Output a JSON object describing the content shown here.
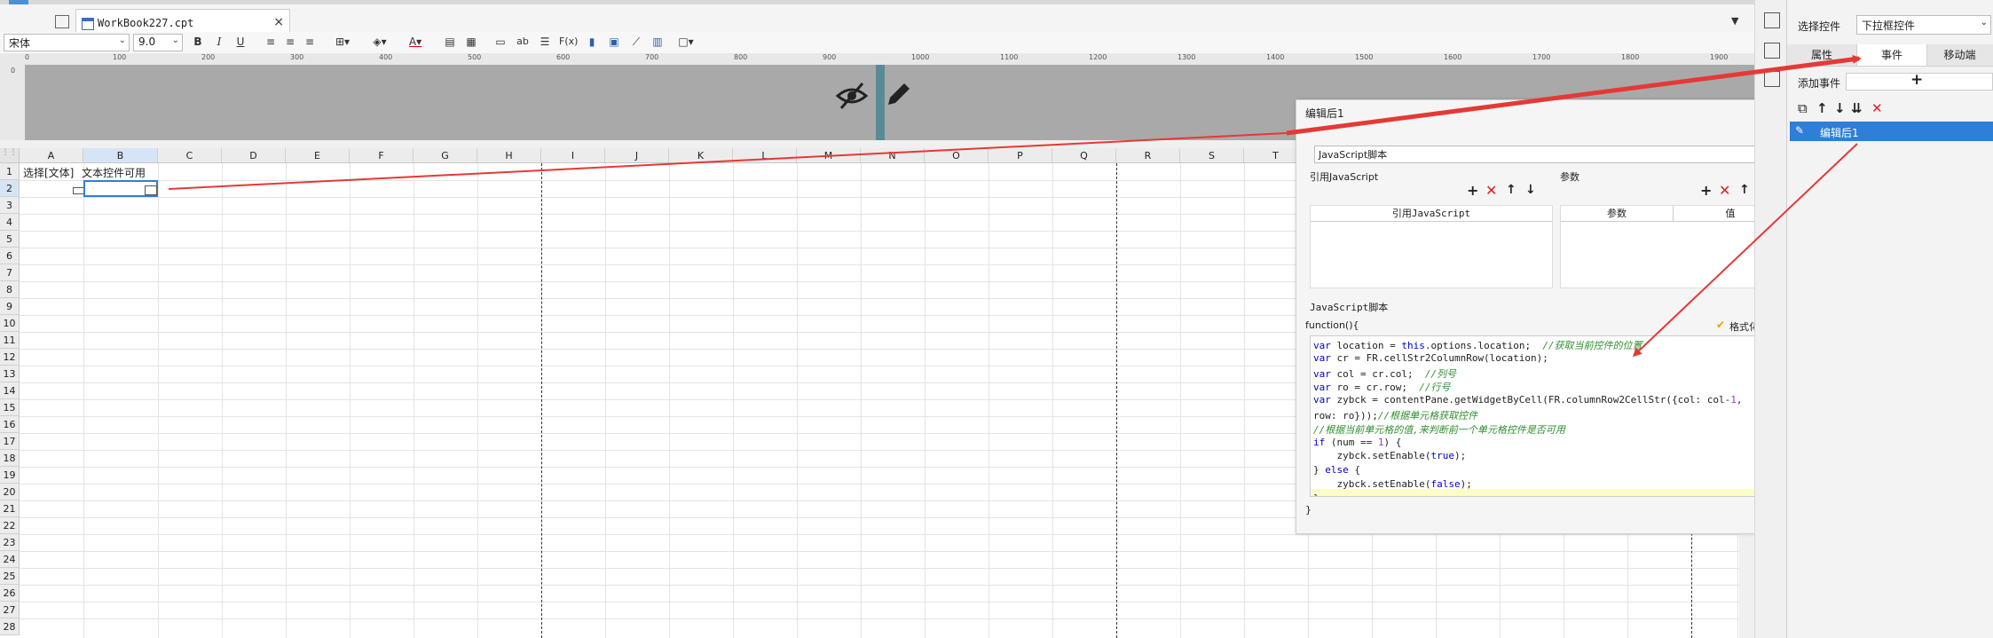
{
  "tabs": [
    {
      "title": "WorkBook227.cpt",
      "close": "×"
    }
  ],
  "toolbar": {
    "font": "宋体",
    "size": "9.0",
    "icons": [
      "bold-icon",
      "italic-icon",
      "underline-icon",
      "align-left-icon",
      "align-center-icon",
      "align-right-icon",
      "border-icon",
      "fill-color-icon",
      "font-color-icon",
      "merge-icon",
      "split-icon",
      "text-icon",
      "ab-icon",
      "wrap-icon",
      "formula-icon",
      "chart-icon",
      "image-icon",
      "slash-icon",
      "highlight-icon",
      "frame-icon"
    ]
  },
  "ruler": {
    "ticks": [
      "0",
      "100",
      "200",
      "300",
      "400",
      "500",
      "600",
      "700",
      "800",
      "900",
      "1000",
      "1100",
      "1200",
      "1300",
      "1400",
      "1500",
      "1600",
      "1700",
      "1800",
      "1900"
    ],
    "vtick": "0"
  },
  "sheet": {
    "columns": [
      "A",
      "B",
      "C",
      "D",
      "E",
      "F",
      "G",
      "H",
      "I",
      "J",
      "K",
      "L",
      "M",
      "N",
      "O",
      "P",
      "Q",
      "R",
      "S",
      "T"
    ],
    "rows": [
      "1",
      "2",
      "3",
      "4",
      "5",
      "6",
      "7",
      "8",
      "9",
      "10",
      "11",
      "12",
      "13",
      "14",
      "15",
      "16",
      "17",
      "18",
      "19",
      "20",
      "21",
      "22",
      "23",
      "24",
      "25",
      "26",
      "27",
      "28"
    ],
    "cells": {
      "a1": "选择[文体]",
      "b1": "文本控件可用"
    }
  },
  "right_panel": {
    "select_widget_label": "选择控件",
    "widget_value": "下拉框控件",
    "tabs": [
      "属性",
      "事件",
      "移动端"
    ],
    "add_event_label": "添加事件",
    "add_event_btn": "+",
    "selected_event": "编辑后1"
  },
  "dialog": {
    "title": "编辑后1",
    "type": "JavaScript脚本",
    "ref_js_label": "引用JavaScript",
    "params_label": "参数",
    "ref_js_col": "引用JavaScript",
    "param_col": "参数",
    "value_col": "值",
    "script_label": "JavaScript脚本",
    "format_btn": "格式化代码",
    "fn_open": "function(){",
    "fn_close": "}",
    "code": [
      {
        "parts": [
          [
            "kw",
            "var"
          ],
          [
            "t",
            " location = "
          ],
          [
            "kw",
            "this"
          ],
          [
            "t",
            ".options.location;  "
          ],
          [
            "cm",
            "//获取当前控件的位置"
          ]
        ]
      },
      {
        "parts": [
          [
            "kw",
            "var"
          ],
          [
            "t",
            " cr = FR.cellStr2ColumnRow(location);"
          ]
        ]
      },
      {
        "parts": [
          [
            "kw",
            "var"
          ],
          [
            "t",
            " col = cr.col;  "
          ],
          [
            "cm",
            "//列号"
          ]
        ]
      },
      {
        "parts": [
          [
            "kw",
            "var"
          ],
          [
            "t",
            " ro = cr.row;  "
          ],
          [
            "cm",
            "//行号"
          ]
        ]
      },
      {
        "parts": [
          [
            "kw",
            "var"
          ],
          [
            "t",
            " zybck = contentPane.getWidgetByCell(FR.columnRow2CellStr({col: col-"
          ],
          [
            "num",
            "1"
          ],
          [
            "t",
            ","
          ]
        ]
      },
      {
        "parts": [
          [
            "t",
            "row: ro}));"
          ],
          [
            "cm",
            "//根据单元格获取控件"
          ]
        ]
      },
      {
        "parts": [
          [
            "cm",
            "//根据当前单元格的值,来判断前一个单元格控件是否可用"
          ]
        ]
      },
      {
        "parts": [
          [
            "kw",
            "if"
          ],
          [
            "t",
            " (num == "
          ],
          [
            "num",
            "1"
          ],
          [
            "t",
            ") {"
          ]
        ]
      },
      {
        "parts": [
          [
            "t",
            "    zybck.setEnable("
          ],
          [
            "kw",
            "true"
          ],
          [
            "t",
            ");"
          ]
        ]
      },
      {
        "parts": [
          [
            "t",
            "} "
          ],
          [
            "kw",
            "else"
          ],
          [
            "t",
            " {"
          ]
        ]
      },
      {
        "parts": [
          [
            "t",
            "    zybck.setEnable("
          ],
          [
            "kw",
            "false"
          ],
          [
            "t",
            ");"
          ]
        ]
      },
      {
        "parts": [
          [
            "t",
            "}"
          ]
        ]
      }
    ]
  },
  "colors": {
    "accent": "#2f7ed8",
    "arrow": "#e53935"
  }
}
